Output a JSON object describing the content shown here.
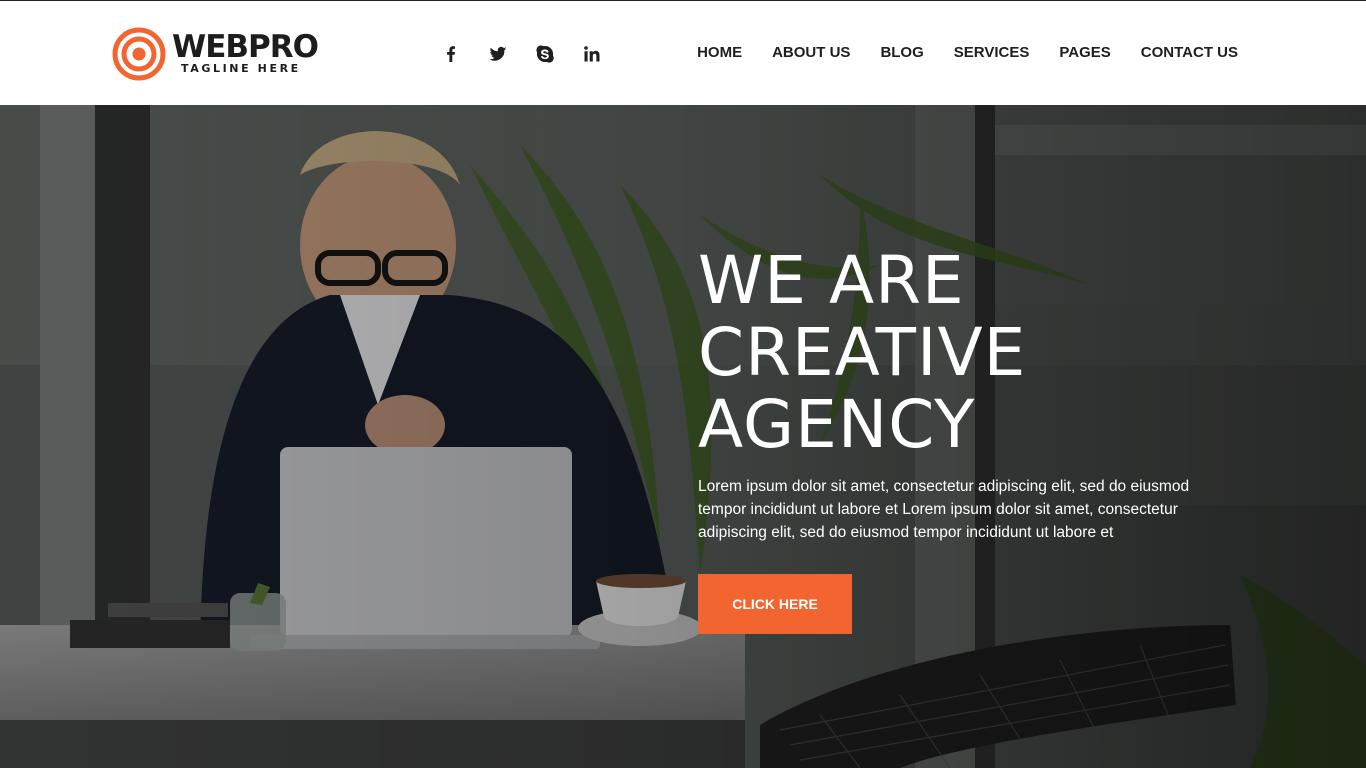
{
  "brand": {
    "name": "WEBPRO",
    "tagline": "TAGLINE HERE",
    "accent_color": "#f26531"
  },
  "social": [
    {
      "name": "facebook-icon"
    },
    {
      "name": "twitter-icon"
    },
    {
      "name": "skype-icon"
    },
    {
      "name": "linkedin-icon"
    }
  ],
  "nav": {
    "items": [
      "HOME",
      "ABOUT US",
      "BLOG",
      "SERVICES",
      "PAGES",
      "CONTACT US"
    ]
  },
  "hero": {
    "title_lines": [
      "WE ARE",
      "CREATIVE",
      "AGENCY"
    ],
    "description": "Lorem ipsum dolor sit amet, consectetur adipiscing elit, sed do eiusmod tempor incididunt ut labore et Lorem ipsum dolor sit amet, consectetur adipiscing elit, sed do eiusmod tempor incididunt ut labore et",
    "button_label": "CLICK HERE"
  }
}
